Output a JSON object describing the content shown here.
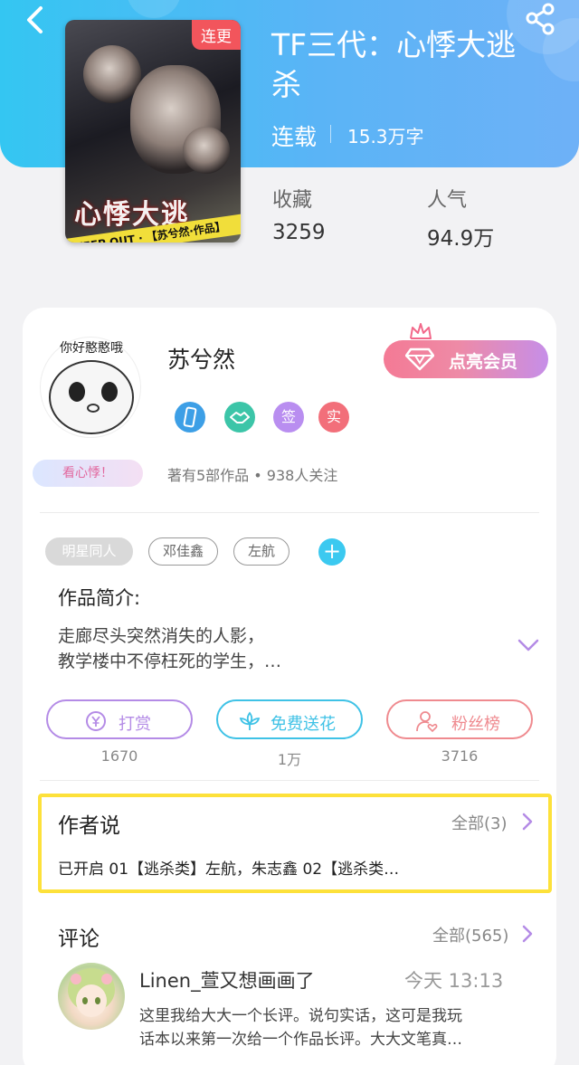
{
  "header": {
    "back_icon": "chevron-left-icon",
    "share_icon": "share-icon"
  },
  "book": {
    "cover_badge": "连更",
    "cover_title": "心悸大逃",
    "cover_tape": "KEEP OUT · 【苏兮然·作品】",
    "title": "TF三代：心悸大逃杀",
    "status": "连载",
    "word_count": "15.3万字",
    "stats": [
      {
        "label": "收藏",
        "value": "3259"
      },
      {
        "label": "人气",
        "value": "94.9万"
      }
    ]
  },
  "author": {
    "avatar_text": "你好憨憨哦",
    "reading_tag": "看心悸！",
    "name": "苏兮然",
    "vip_button": "点亮会员",
    "badges": [
      {
        "label": "",
        "icon": "phone-icon",
        "color": "#3d9fe6"
      },
      {
        "label": "",
        "icon": "handshake-icon",
        "color": "#3cc5a8"
      },
      {
        "label": "签",
        "icon": "signed-icon",
        "color": "#b98ef0"
      },
      {
        "label": "实",
        "icon": "verified-icon",
        "color": "#f26f7a"
      }
    ],
    "meta": "著有5部作品 • 938人关注"
  },
  "tags": [
    "明星同人",
    "邓佳鑫",
    "左航"
  ],
  "intro": {
    "heading": "作品简介:",
    "lines": [
      "走廊尽头突然消失的人影，",
      "教学楼中不停枉死的学生，…"
    ]
  },
  "actions": [
    {
      "label": "打赏",
      "count": "1670",
      "icon": "yen-icon",
      "color": "#b48be6"
    },
    {
      "label": "免费送花",
      "count": "1万",
      "icon": "flower-icon",
      "color": "#3fc2e6"
    },
    {
      "label": "粉丝榜",
      "count": "3716",
      "icon": "fan-heart-icon",
      "color": "#ef8a8f"
    }
  ],
  "author_says": {
    "title": "作者说",
    "more": "全部(3)",
    "text": "已开启 01【逃杀类】左航，朱志鑫 02【逃杀类…"
  },
  "comments": {
    "title": "评论",
    "more": "全部(565)",
    "items": [
      {
        "user": "Linen_萱又想画画了",
        "time": "今天 13:13",
        "lines": [
          "这里我给大大一个长评。说句实话，这可是我玩",
          "话本以来第一次给一个作品长评。大大文笔真…"
        ]
      }
    ]
  },
  "colors": {
    "header_gradient_start": "#34c6f2",
    "header_gradient_end": "#6eb1f7",
    "vip_gradient_start": "#f47a95",
    "vip_gradient_end": "#c68ee8",
    "highlight_border": "#fde13a",
    "tag_add": "#3bc9f0"
  }
}
